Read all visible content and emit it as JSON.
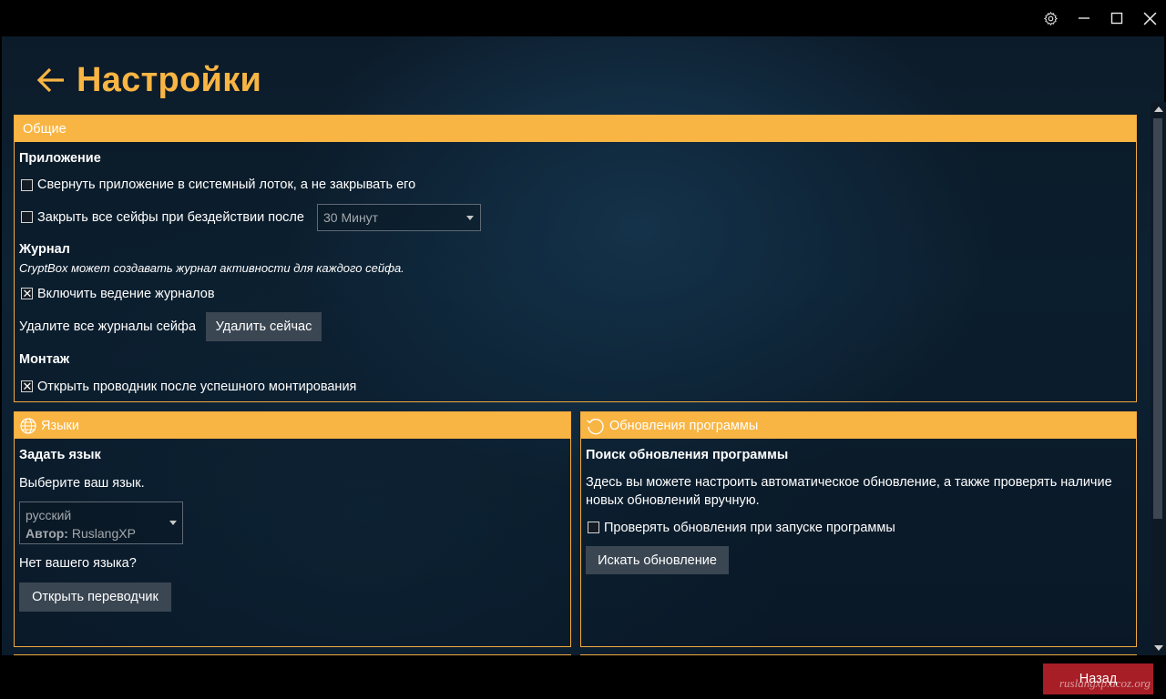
{
  "window": {
    "controls": {
      "settings_icon": "gear-icon",
      "minimize": "—",
      "maximize": "☐",
      "close": "✕"
    }
  },
  "header": {
    "title": "Настройки",
    "back_icon": "arrow-left-icon"
  },
  "general": {
    "heading": "Общие",
    "app": {
      "title": "Приложение",
      "minimize_tray": {
        "label": "Свернуть приложение в системный лоток, а не закрывать его",
        "checked": false
      },
      "close_vaults": {
        "label": "Закрыть все сейфы при бездействии после",
        "checked": false,
        "value": "30 Минут"
      }
    },
    "journal": {
      "title": "Журнал",
      "description": "CryptBox может создавать журнал активности для каждого сейфа.",
      "enable": {
        "label": "Включить ведение журналов",
        "checked": true
      },
      "delete_label": "Удалите все журналы сейфа",
      "delete_button": "Удалить сейчас"
    },
    "mount": {
      "title": "Монтаж",
      "open_explorer": {
        "label": "Открыть проводник после успешного монтирования",
        "checked": true
      }
    }
  },
  "languages": {
    "heading": "Языки",
    "icon": "globe-icon",
    "set_title": "Задать язык",
    "prompt": "Выберите ваш язык.",
    "selected": "русский",
    "author_label": "Автор:",
    "author_name": "RuslangXP",
    "missing": "Нет вашего языка?",
    "translator_button": "Открыть переводчик"
  },
  "updates": {
    "heading": "Обновления программы",
    "icon": "refresh-icon",
    "title": "Поиск обновления программы",
    "description_line1": "Здесь вы можете настроить автоматическое обновление, а также проверять наличие",
    "description_line2": "новых обновлений вручную.",
    "check_on_start": {
      "label": "Проверять обновления при запуске программы",
      "checked": false
    },
    "search_button": "Искать обновление"
  },
  "footer": {
    "back_button": "Назад",
    "watermark": "ruslangxp.ucoz.org"
  }
}
